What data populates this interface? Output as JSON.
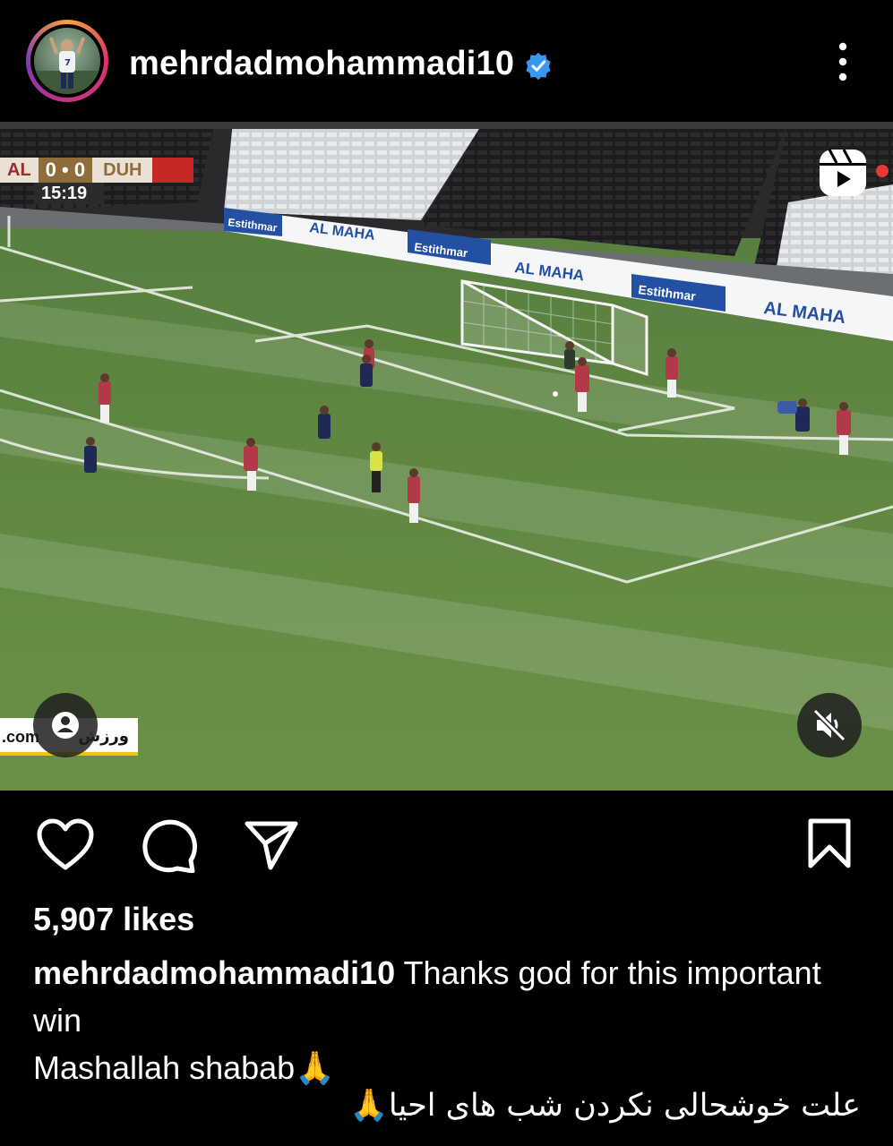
{
  "post": {
    "username": "mehrdadmohammadi10",
    "verified_icon": "verified-badge-icon",
    "likes": "5,907 likes",
    "caption_username": "mehrdadmohammadi10",
    "caption_text": " Thanks god for this important win",
    "caption_line2": "Mashallah shabab",
    "caption_line3_rtl": "علت خوشحالی نکردن شب های احیا",
    "emoji": "🙏"
  },
  "video": {
    "scoreboard": {
      "home": "AL",
      "score_home": "0",
      "score_separator": "•",
      "score_away": "0",
      "away": "DUH",
      "clock": "15:19"
    },
    "ads": [
      "Estithmar",
      "AL MAHA",
      "Estithmar",
      "AL MAHA",
      "Estithmar",
      "AL MAHA"
    ],
    "watermark_left": ".com",
    "watermark_right": "ورزش",
    "icons": {
      "reels": "reels-icon",
      "tag": "user-tag-icon",
      "mute": "muted-speaker-icon"
    }
  },
  "actions": {
    "like": "heart-icon",
    "comment": "comment-icon",
    "share": "send-icon",
    "save": "bookmark-icon",
    "more": "more-vertical-icon"
  },
  "colors": {
    "background": "#000000",
    "text": "#ffffff",
    "verified": "#3897f0",
    "pitch": "#5a7f3e",
    "home_kit": "#b23a48",
    "away_kit": "#1e2a55"
  }
}
